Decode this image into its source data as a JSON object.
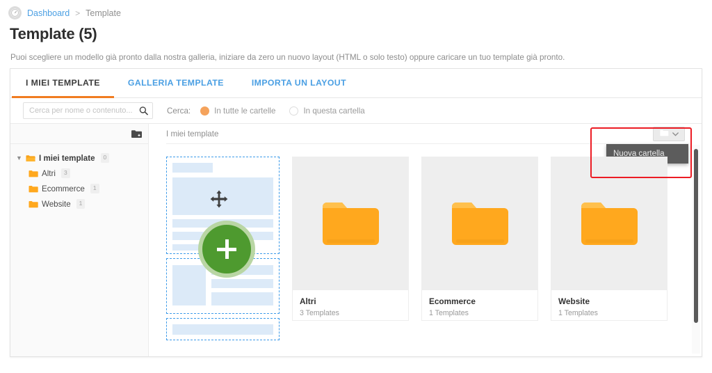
{
  "breadcrumb": {
    "icon": "dashboard-gauge-icon",
    "link": "Dashboard",
    "separator": ">",
    "current": "Template"
  },
  "header": {
    "title": "Template (5)",
    "subtitle": "Puoi scegliere un modello già pronto dalla nostra galleria, iniziare da zero un nuovo layout (HTML o solo testo) oppure caricare un tuo template già pronto."
  },
  "tabs": [
    {
      "label": "I MIEI TEMPLATE",
      "active": true
    },
    {
      "label": "GALLERIA TEMPLATE",
      "active": false
    },
    {
      "label": "IMPORTA UN LAYOUT",
      "active": false
    }
  ],
  "search": {
    "placeholder": "Cerca per nome o contenuto...",
    "value": "",
    "icon": "search-icon",
    "label": "Cerca:",
    "options": [
      {
        "label": "In tutte le cartelle",
        "checked": true
      },
      {
        "label": "In questa cartella",
        "checked": false
      }
    ]
  },
  "sidebar": {
    "new_folder_icon": "folder-plus-icon",
    "collapse_icon": "chevron-left-icon",
    "tree": [
      {
        "label": "I miei template",
        "count": "0",
        "level": 0,
        "expanded": true
      },
      {
        "label": "Altri",
        "count": "3",
        "level": 1
      },
      {
        "label": "Ecommerce",
        "count": "1",
        "level": 1
      },
      {
        "label": "Website",
        "count": "1",
        "level": 1
      }
    ]
  },
  "content": {
    "path_label": "I miei template",
    "dropdown": {
      "icon": "folder-icon",
      "chevron": "chevron-down-icon",
      "menu": [
        {
          "label": "Nuova cartella"
        }
      ]
    },
    "new_template": {
      "move_icon": "move-arrows-icon",
      "add_icon": "plus-icon"
    },
    "folders": [
      {
        "icon": "folder-icon",
        "title": "Altri",
        "count": "3 Templates"
      },
      {
        "icon": "folder-icon",
        "title": "Ecommerce",
        "count": "1 Templates"
      },
      {
        "icon": "folder-icon",
        "title": "Website",
        "count": "1 Templates"
      }
    ]
  },
  "colors": {
    "accent_orange": "#f07c20",
    "link_blue": "#4a9fe3",
    "folder_orange": "#ffa81e",
    "add_green": "#4e9a2f",
    "highlight_red": "#ec1c24",
    "menu_dark": "#5c5c5c"
  }
}
